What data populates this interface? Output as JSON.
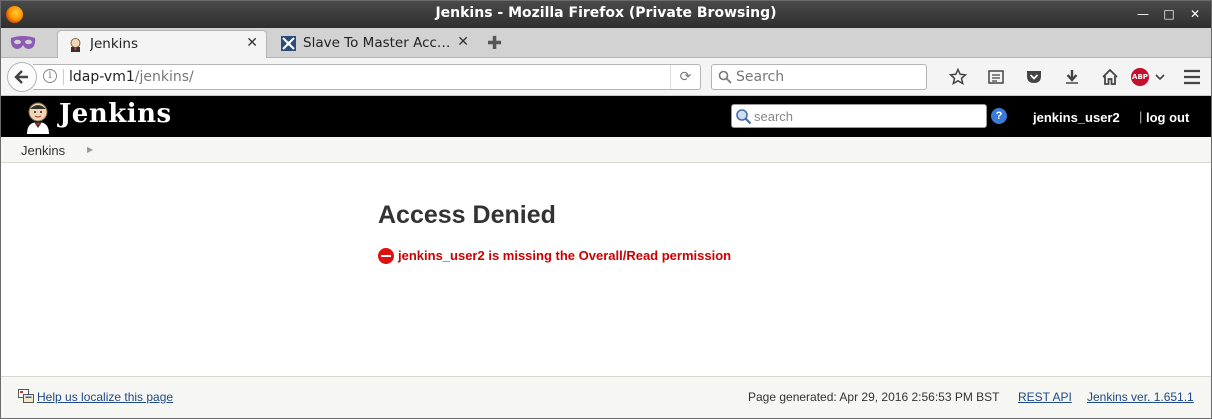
{
  "window": {
    "title": "Jenkins - Mozilla Firefox (Private Browsing)"
  },
  "tabs": [
    {
      "label": "Jenkins",
      "active": true,
      "favicon": "jenkins-icon"
    },
    {
      "label": "Slave To Master Acc…",
      "active": false,
      "favicon": "security-icon"
    }
  ],
  "navbar": {
    "url_host": "ldap-vm1",
    "url_path": "/jenkins/",
    "search_placeholder": "Search"
  },
  "jenkins": {
    "brand": "Jenkins",
    "search_placeholder": "search",
    "user": "jenkins_user2",
    "logout_separator": "|",
    "logout": "log out",
    "breadcrumb": "Jenkins",
    "heading": "Access Denied",
    "error_message": "jenkins_user2 is missing the Overall/Read permission",
    "error_color": "#cc0000"
  },
  "footer": {
    "localize_link": "Help us localize this page",
    "generated": "Page generated: Apr 29, 2016 2:56:53 PM BST",
    "rest_api": "REST API",
    "version": "Jenkins ver. 1.651.1"
  }
}
